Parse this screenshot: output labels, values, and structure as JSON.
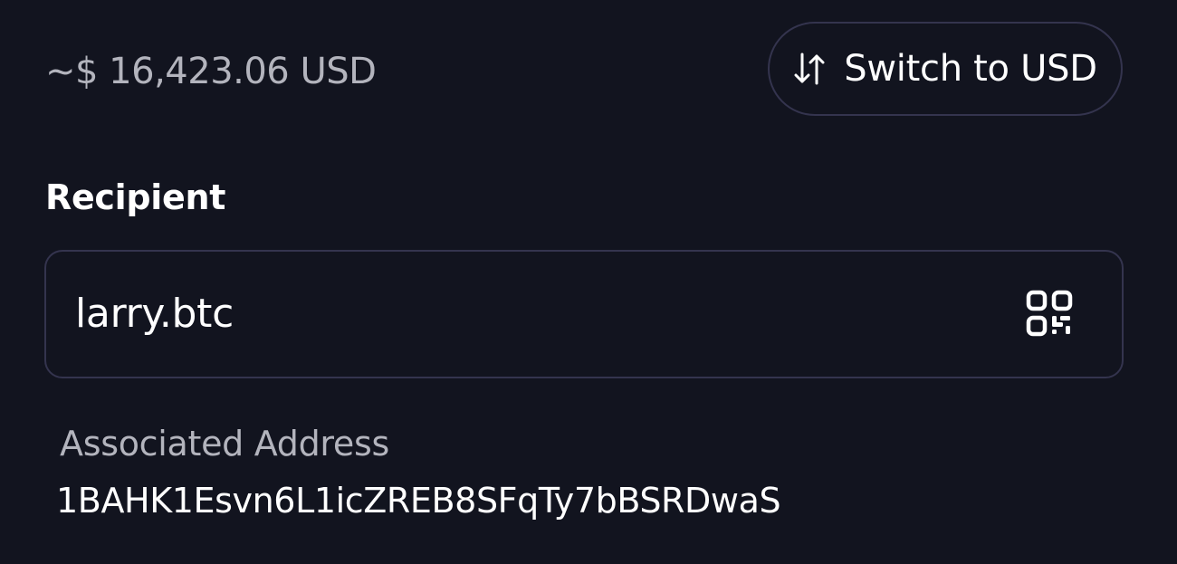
{
  "amount": {
    "usd_estimate": "~$ 16,423.06 USD"
  },
  "switch_button": {
    "label": "Switch to USD",
    "icon": "swap-vertical-icon"
  },
  "recipient": {
    "label": "Recipient",
    "value": "larry.btc",
    "scan_icon": "qr-code-icon"
  },
  "associated_address": {
    "label": "Associated Address",
    "value": "1BAHK1Esvn6L1icZREB8SFqTy7bBSRDwaS"
  },
  "colors": {
    "background": "#12141f",
    "border": "#34344e",
    "text_primary": "#ffffff",
    "text_secondary": "#b3b4bd"
  }
}
